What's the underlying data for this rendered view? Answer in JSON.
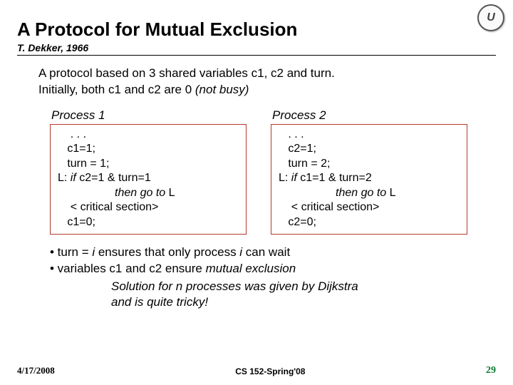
{
  "logo_text": "U",
  "title": "A Protocol for Mutual Exclusion",
  "subtitle": "T. Dekker, 1966",
  "intro_line1": "A protocol based on 3 shared variables c1, c2 and turn.",
  "intro_line2_a": "Initially, both c1 and c2 are 0 ",
  "intro_line2_b": "(not busy)",
  "process1": {
    "heading": "Process 1",
    "l1": "    . . .",
    "l2": "   c1=1;",
    "l3": "   turn = 1;",
    "l4a": "L: ",
    "l4b": "if",
    "l4c": " c2=1 & turn=1",
    "l5a": "                  ",
    "l5b": "then go to",
    "l5c": " L",
    "l6": "    < critical section>",
    "l7": "   c1=0;"
  },
  "process2": {
    "heading": "Process 2",
    "l1": "   . . .",
    "l2": "   c2=1;",
    "l3": "   turn = 2;",
    "l4a": "L: ",
    "l4b": "if",
    "l4c": " c1=1 & turn=2",
    "l5a": "                  ",
    "l5b": "then go to",
    "l5c": " L",
    "l6": "    < critical section>",
    "l7": "   c2=0;"
  },
  "bullet1_a": "• turn = ",
  "bullet1_b": "i",
  "bullet1_c": " ensures that only process ",
  "bullet1_d": "i",
  "bullet1_e": " can wait",
  "bullet2_a": "• variables c1 and c2 ensure ",
  "bullet2_b": "mutual exclusion",
  "solution_l1": "Solution for n processes was given by Dijkstra",
  "solution_l2": "and is quite tricky!",
  "footer": {
    "date": "4/17/2008",
    "course": "CS 152-Spring'08",
    "page": "29"
  }
}
